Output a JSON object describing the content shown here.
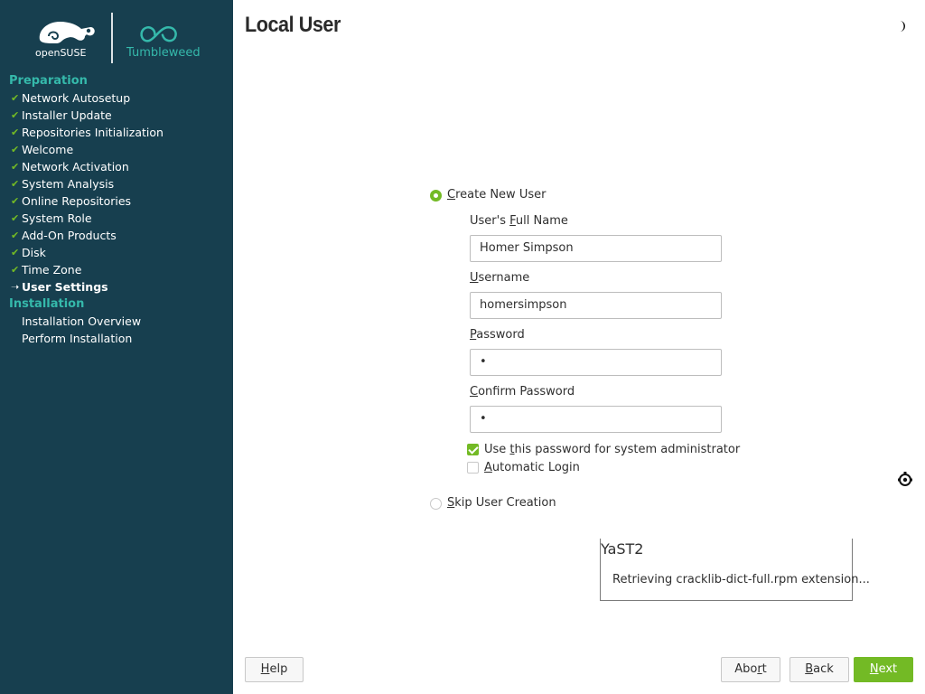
{
  "brand": {
    "opensuse": "openSUSE",
    "product": "Tumbleweed",
    "accent": "#73ba25",
    "sidebar_bg": "#173f4f",
    "section_color": "#35b9ab"
  },
  "sidebar": {
    "sections": [
      {
        "title": "Preparation",
        "items": [
          {
            "label": "Network Autosetup",
            "state": "done"
          },
          {
            "label": "Installer Update",
            "state": "done"
          },
          {
            "label": "Repositories Initialization",
            "state": "done"
          },
          {
            "label": "Welcome",
            "state": "done"
          },
          {
            "label": "Network Activation",
            "state": "done"
          },
          {
            "label": "System Analysis",
            "state": "done"
          },
          {
            "label": "Online Repositories",
            "state": "done"
          },
          {
            "label": "System Role",
            "state": "done"
          },
          {
            "label": "Add-On Products",
            "state": "done"
          },
          {
            "label": "Disk",
            "state": "done"
          },
          {
            "label": "Time Zone",
            "state": "done"
          },
          {
            "label": "User Settings",
            "state": "current"
          }
        ]
      },
      {
        "title": "Installation",
        "items": [
          {
            "label": "Installation Overview",
            "state": "pending"
          },
          {
            "label": "Perform Installation",
            "state": "pending"
          }
        ]
      }
    ]
  },
  "page": {
    "title": "Local User"
  },
  "form": {
    "create_user": {
      "label_u": "C",
      "label_rest": "reate New User",
      "checked": true
    },
    "full_name": {
      "label_pre": "User's ",
      "label_u": "F",
      "label_rest": "ull Name",
      "value": "Homer Simpson"
    },
    "username": {
      "label_u": "U",
      "label_rest": "sername",
      "value": "homersimpson"
    },
    "password": {
      "label_u": "P",
      "label_rest": "assword",
      "value": "•"
    },
    "confirm": {
      "label_u": "C",
      "label_rest": "onfirm Password",
      "value": "•"
    },
    "use_for_admin": {
      "label_pre": "Use ",
      "label_u": "t",
      "label_rest": "his password for system administrator",
      "checked": true
    },
    "auto_login": {
      "label_u": "A",
      "label_rest": "utomatic Login",
      "checked": false
    },
    "skip": {
      "label_u": "S",
      "label_rest": "kip User Creation",
      "checked": false
    }
  },
  "popup": {
    "title": "YaST2",
    "message": "Retrieving cracklib-dict-full.rpm extension..."
  },
  "buttons": {
    "help": {
      "u": "H",
      "rest": "elp"
    },
    "abort": {
      "pre": "Abo",
      "u": "r",
      "rest": "t"
    },
    "back": {
      "u": "B",
      "rest": "ack"
    },
    "next": {
      "u": "N",
      "rest": "ext"
    }
  },
  "icons": {
    "theme": "half-moon-icon",
    "side": "accessibility-icon"
  }
}
